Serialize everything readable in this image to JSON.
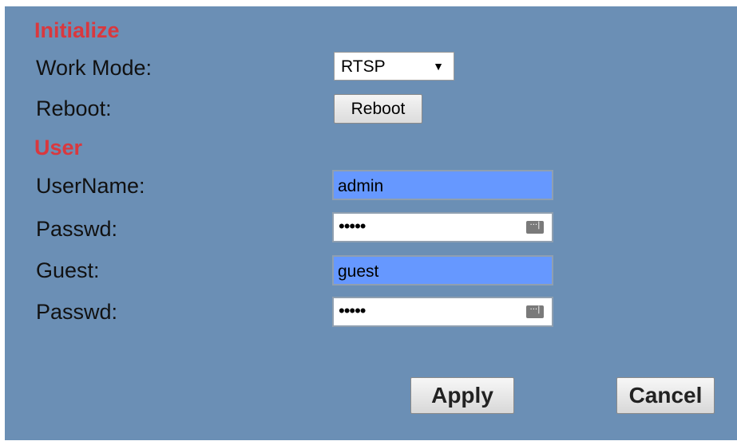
{
  "initialize": {
    "heading": "Initialize",
    "work_mode_label": "Work Mode:",
    "work_mode_value": "RTSP",
    "reboot_label": "Reboot:",
    "reboot_button": "Reboot"
  },
  "user": {
    "heading": "User",
    "username_label": "UserName:",
    "username_value": "admin",
    "passwd_label": "Passwd:",
    "passwd_mask": "•••••",
    "guest_label": "Guest:",
    "guest_value": "guest",
    "guest_passwd_label": "Passwd:",
    "guest_passwd_mask": "•••••"
  },
  "actions": {
    "apply": "Apply",
    "cancel": "Cancel"
  },
  "icons": {
    "dropdown": "chevron-down-icon",
    "password_key": "password-key-icon"
  },
  "colors": {
    "panel": "#6b8fb5",
    "heading": "#d9383e",
    "autofill": "#6698ff"
  }
}
